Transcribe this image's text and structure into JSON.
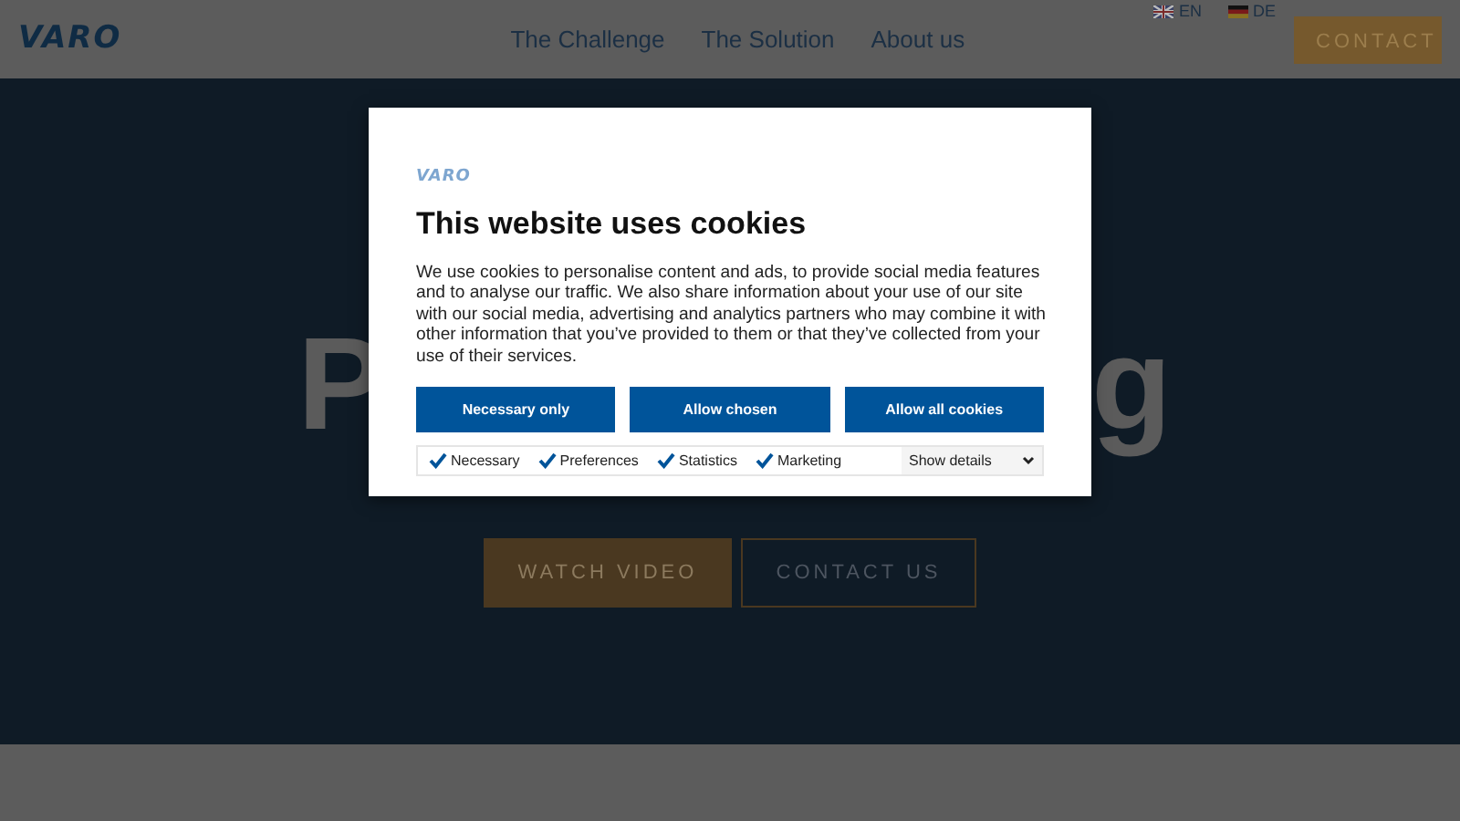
{
  "header": {
    "logo": "VARO",
    "nav": [
      "The Challenge",
      "The Solution",
      "About us"
    ],
    "languages": [
      {
        "code": "EN"
      },
      {
        "code": "DE"
      }
    ],
    "contact_button": "CONTACT"
  },
  "hero": {
    "title_parts": [
      "P",
      "g"
    ],
    "buttons": [
      {
        "label": "WATCH VIDEO",
        "kind": "filled"
      },
      {
        "label": "CONTACT US",
        "kind": "outline"
      }
    ]
  },
  "cookie_dialog": {
    "logo": "VARO",
    "title": "This website uses cookies",
    "text": "We use cookies to personalise content and ads, to provide social media features and to analyse our traffic. We also share information about your use of our site with our social media, advertising and analytics partners who may combine it with other information that you’ve provided to them or that they’ve collected from your use of their services.",
    "buttons": [
      "Necessary only",
      "Allow chosen",
      "Allow all cookies"
    ],
    "checkboxes": [
      {
        "label": "Necessary",
        "checked": true
      },
      {
        "label": "Preferences",
        "checked": true
      },
      {
        "label": "Statistics",
        "checked": true
      },
      {
        "label": "Marketing",
        "checked": true
      }
    ],
    "details_select": "Show details"
  }
}
